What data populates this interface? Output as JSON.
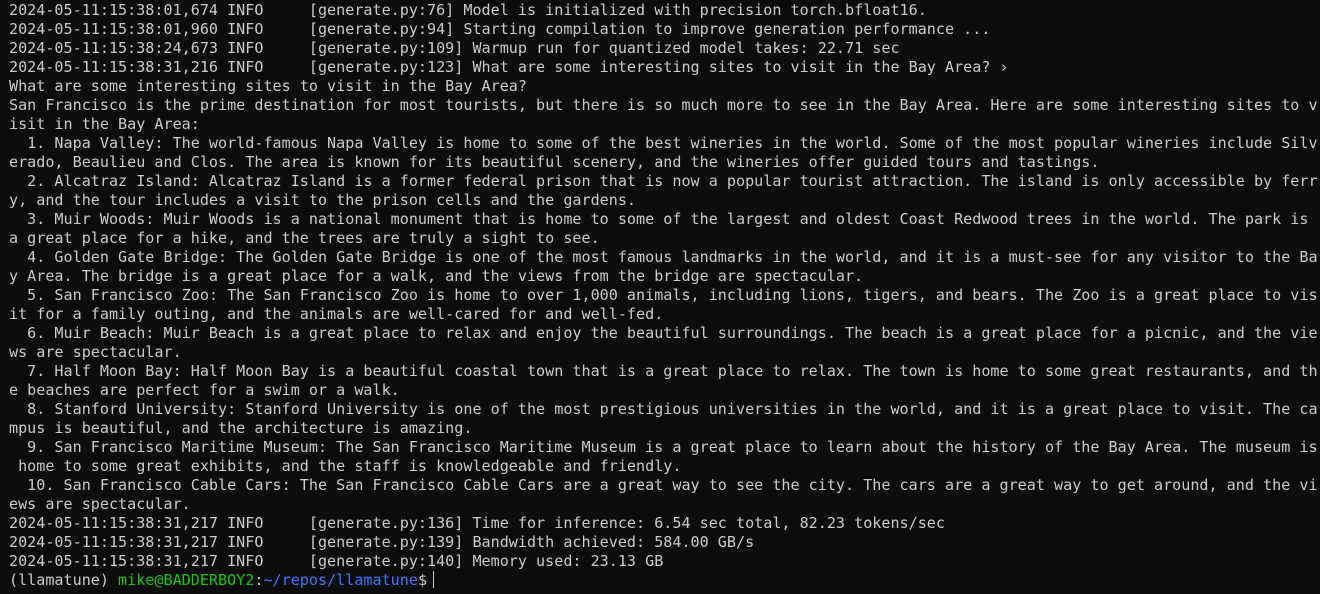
{
  "terminal": {
    "lines": [
      "2024-05-11:15:38:01,674 INFO     [generate.py:76] Model is initialized with precision torch.bfloat16.",
      "2024-05-11:15:38:01,960 INFO     [generate.py:94] Starting compilation to improve generation performance ...",
      "2024-05-11:15:38:24,673 INFO     [generate.py:109] Warmup run for quantized model takes: 22.71 sec",
      "2024-05-11:15:38:31,216 INFO     [generate.py:123] What are some interesting sites to visit in the Bay Area? ›",
      "What are some interesting sites to visit in the Bay Area?",
      "San Francisco is the prime destination for most tourists, but there is so much more to see in the Bay Area. Here are some interesting sites to v",
      "isit in the Bay Area:",
      "  1. Napa Valley: The world-famous Napa Valley is home to some of the best wineries in the world. Some of the most popular wineries include Silv",
      "erado, Beaulieu and Clos. The area is known for its beautiful scenery, and the wineries offer guided tours and tastings.",
      "  2. Alcatraz Island: Alcatraz Island is a former federal prison that is now a popular tourist attraction. The island is only accessible by ferr",
      "y, and the tour includes a visit to the prison cells and the gardens.",
      "  3. Muir Woods: Muir Woods is a national monument that is home to some of the largest and oldest Coast Redwood trees in the world. The park is",
      "a great place for a hike, and the trees are truly a sight to see.",
      "  4. Golden Gate Bridge: The Golden Gate Bridge is one of the most famous landmarks in the world, and it is a must-see for any visitor to the Ba",
      "y Area. The bridge is a great place for a walk, and the views from the bridge are spectacular.",
      "  5. San Francisco Zoo: The San Francisco Zoo is home to over 1,000 animals, including lions, tigers, and bears. The Zoo is a great place to vis",
      "it for a family outing, and the animals are well-cared for and well-fed.",
      "  6. Muir Beach: Muir Beach is a great place to relax and enjoy the beautiful surroundings. The beach is a great place for a picnic, and the vie",
      "ws are spectacular.",
      "  7. Half Moon Bay: Half Moon Bay is a beautiful coastal town that is a great place to relax. The town is home to some great restaurants, and th",
      "e beaches are perfect for a swim or a walk.",
      "  8. Stanford University: Stanford University is one of the most prestigious universities in the world, and it is a great place to visit. The ca",
      "mpus is beautiful, and the architecture is amazing.",
      "  9. San Francisco Maritime Museum: The San Francisco Maritime Museum is a great place to learn about the history of the Bay Area. The museum is",
      " home to some great exhibits, and the staff is knowledgeable and friendly.",
      "  10. San Francisco Cable Cars: The San Francisco Cable Cars are a great way to see the city. The cars are a great way to get around, and the vi",
      "ews are spectacular.",
      "2024-05-11:15:38:31,217 INFO     [generate.py:136] Time for inference: 6.54 sec total, 82.23 tokens/sec",
      "2024-05-11:15:38:31,217 INFO     [generate.py:139] Bandwidth achieved: 584.00 GB/s",
      "2024-05-11:15:38:31,217 INFO     [generate.py:140] Memory used: 23.13 GB"
    ],
    "prompt": {
      "env": "(llamatune) ",
      "user_host": "mike@BADDERBOY2",
      "sep": ":",
      "path": "~/repos/llamatune",
      "symbol": "$"
    },
    "colors": {
      "background": "#0c0c0c",
      "text": "#cccccc",
      "user_host": "#16c60c",
      "path": "#3b78ff"
    }
  }
}
